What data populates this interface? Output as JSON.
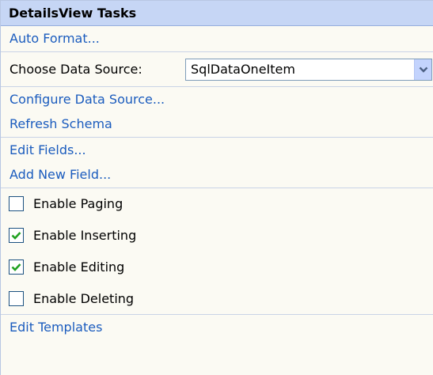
{
  "panel": {
    "title": "DetailsView Tasks",
    "auto_format": "Auto Format...",
    "data_source": {
      "label": "Choose Data Source:",
      "selected": "SqlDataOneItem"
    },
    "configure_data_source": "Configure Data Source...",
    "refresh_schema": "Refresh Schema",
    "edit_fields": "Edit Fields...",
    "add_new_field": "Add New Field...",
    "options": [
      {
        "label": "Enable Paging",
        "checked": false
      },
      {
        "label": "Enable Inserting",
        "checked": true
      },
      {
        "label": "Enable Editing",
        "checked": true
      },
      {
        "label": "Enable Deleting",
        "checked": false
      }
    ],
    "edit_templates": "Edit Templates"
  },
  "colors": {
    "header_bg": "#c6d6f5",
    "panel_bg": "#fbfaf3",
    "link": "#1b5cbe",
    "check_mark": "#21a121"
  },
  "icons": {
    "dropdown": "chevron-down-icon",
    "check": "checkmark-icon"
  }
}
